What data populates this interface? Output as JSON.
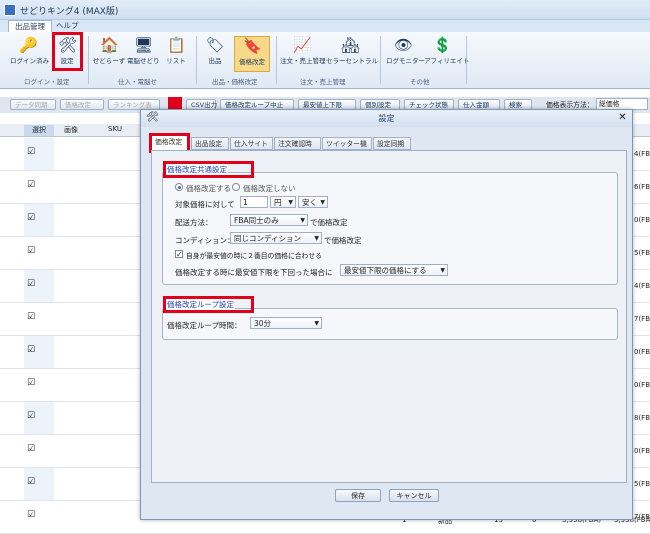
{
  "window": {
    "title": "せどりキング4 (MAX版)"
  },
  "ribbon_tabs": [
    {
      "label": "出品管理"
    },
    {
      "label": "ヘルプ"
    }
  ],
  "ribbon": {
    "buttons": [
      {
        "label": "ログイン済み",
        "icon": "key-icon"
      },
      {
        "label": "設定",
        "icon": "tools-icon"
      },
      {
        "label": "せどらーず",
        "icon": "house-icon"
      },
      {
        "label": "電脳せどり",
        "icon": "computer-icon"
      },
      {
        "label": "リスト",
        "icon": "list-icon"
      },
      {
        "label": "出品",
        "icon": "tag-icon"
      },
      {
        "label": "価格改定",
        "icon": "price-tag-icon"
      },
      {
        "label": "注文・売上管理",
        "icon": "chart-icon"
      },
      {
        "label": "セラーセントラル",
        "icon": "store-icon"
      },
      {
        "label": "ログモニター",
        "icon": "monitor-icon"
      },
      {
        "label": "アフィリエイト",
        "icon": "money-icon"
      }
    ],
    "groups": [
      {
        "label": "ログイン・設定"
      },
      {
        "label": "仕入・電脳せ"
      },
      {
        "label": "出品・価格改定"
      },
      {
        "label": "注文・売上管理"
      },
      {
        "label": "その他"
      }
    ]
  },
  "toolbar": {
    "buttons": [
      {
        "label": "データ同期",
        "disabled": true
      },
      {
        "label": "価格改定",
        "disabled": true
      },
      {
        "label": "ランキング表",
        "disabled": true
      },
      {
        "label": "CSV出力",
        "disabled": false
      },
      {
        "label": "価格改定ループ中止",
        "disabled": false
      },
      {
        "label": "最安値上下限",
        "disabled": false
      },
      {
        "label": "個別設定",
        "disabled": false
      },
      {
        "label": "チェック状態",
        "disabled": false
      },
      {
        "label": "仕入金額",
        "disabled": false
      },
      {
        "label": "検索",
        "disabled": false
      }
    ],
    "price_display_label": "価格表示方法：",
    "price_display_value": "総価格"
  },
  "grid": {
    "headers": [
      "選択",
      "画像",
      "SKU"
    ],
    "rows": [
      {
        "checked": true,
        "tail": "4(FBA"
      },
      {
        "checked": true,
        "tail": "6(FBA"
      },
      {
        "checked": true,
        "tail": "0(FBA"
      },
      {
        "checked": true,
        "tail": "5(FBA"
      },
      {
        "checked": true,
        "tail": "4(FBA"
      },
      {
        "checked": true,
        "tail": "7(FBA"
      },
      {
        "checked": true,
        "tail": "0(FBA"
      },
      {
        "checked": true,
        "tail": "0(FBA"
      },
      {
        "checked": true,
        "tail": "8(FBA"
      },
      {
        "checked": true,
        "tail": "0(FBA"
      },
      {
        "checked": true,
        "tail": "5(FBA"
      },
      {
        "checked": true,
        "tail": "7(FBA"
      }
    ],
    "last_row": {
      "no": "1",
      "condition": "新品",
      "qty": "19",
      "x": "0",
      "price1": "3,958(FBA)",
      "price2": "3,958(FBA"
    }
  },
  "dialog": {
    "title": "設定",
    "tabs": [
      {
        "label": "価格改定"
      },
      {
        "label": "出品設定"
      },
      {
        "label": "仕入サイト"
      },
      {
        "label": "注文確認時"
      },
      {
        "label": "ツイッター機能"
      },
      {
        "label": "設定同期"
      }
    ],
    "common": {
      "legend": "価格改定共通設定",
      "radio_on": "価格改定する",
      "radio_off": "価格改定しない",
      "target_label": "対象価格に対して",
      "amount_value": "1",
      "unit_value": "円",
      "direction_value": "安く",
      "shipping_label": "配送方法：",
      "shipping_value": "FBA同士のみ",
      "shipping_suffix": "で価格改定",
      "condition_label": "コンディション：",
      "condition_value": "同じコンディション",
      "condition_suffix": "で価格改定",
      "second_lowest_label": "自身が最安値の時に２番目の価格に合わせる",
      "lower_limit_label": "価格改定する時に最安値下限を下回った場合に",
      "lower_limit_value": "最安値下限の価格にする"
    },
    "loop": {
      "legend": "価格改定ループ設定",
      "time_label": "価格改定ループ時間：",
      "time_value": "30分"
    },
    "save_label": "保存",
    "cancel_label": "キャンセル"
  }
}
